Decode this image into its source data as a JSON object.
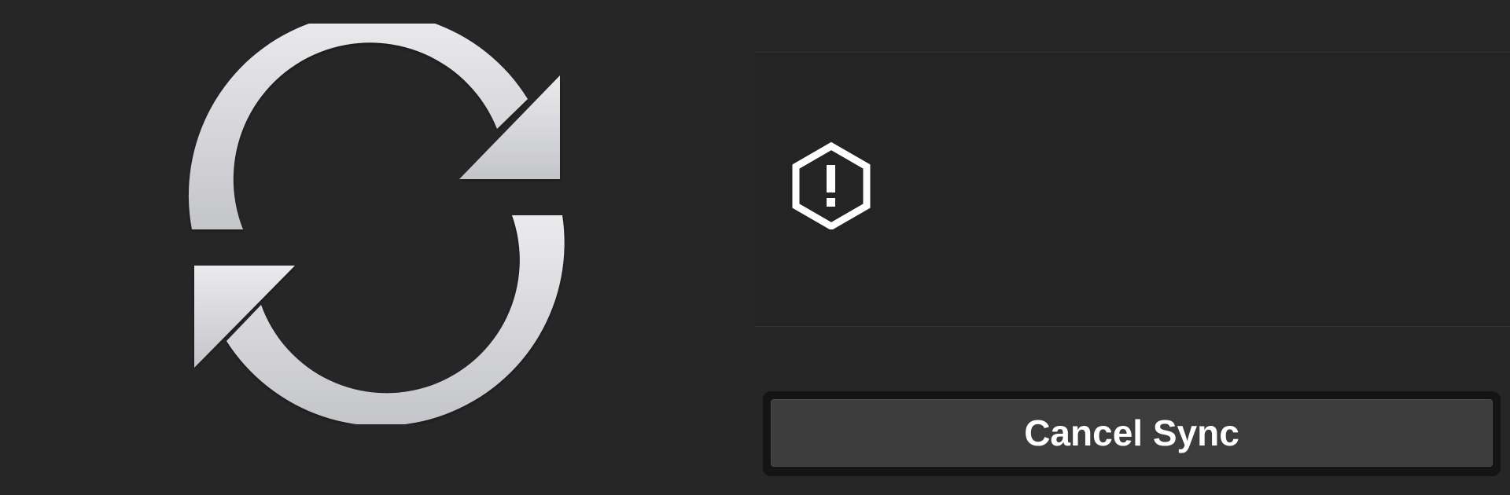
{
  "sync_graphic": {
    "icon": "sync-arrows-icon",
    "color_top": "#ebebee",
    "color_bottom": "#c4c5c9"
  },
  "status_panel": {
    "icon": "warning-hexagon-icon",
    "icon_color": "#ffffff",
    "message": ""
  },
  "actions": {
    "cancel_label": "Cancel Sync"
  },
  "colors": {
    "background": "#262626",
    "button_face": "#3c3c3c",
    "button_well": "#141414"
  }
}
